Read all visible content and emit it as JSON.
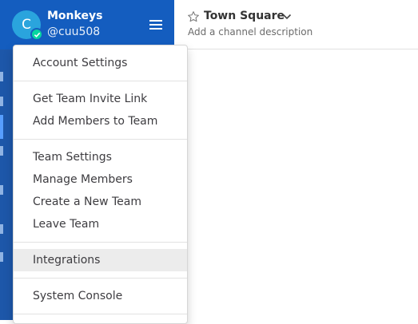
{
  "sidebar": {
    "avatar_letter": "C",
    "team_name": "Monkeys",
    "username": "@cuu508"
  },
  "channel": {
    "name": "Town Square",
    "description": "Add a channel description"
  },
  "menu": {
    "items": [
      {
        "label": "Account Settings"
      },
      {
        "label": "Get Team Invite Link"
      },
      {
        "label": "Add Members to Team"
      },
      {
        "label": "Team Settings"
      },
      {
        "label": "Manage Members"
      },
      {
        "label": "Create a New Team"
      },
      {
        "label": "Leave Team"
      },
      {
        "label": "Integrations",
        "highlighted": true
      },
      {
        "label": "System Console"
      }
    ]
  },
  "colors": {
    "sidebar": "#1d57a9",
    "sidebar_header": "#145dbf",
    "avatar": "#2aa4dd",
    "status_online": "#06d6a0",
    "menu_highlight": "#ececec"
  }
}
